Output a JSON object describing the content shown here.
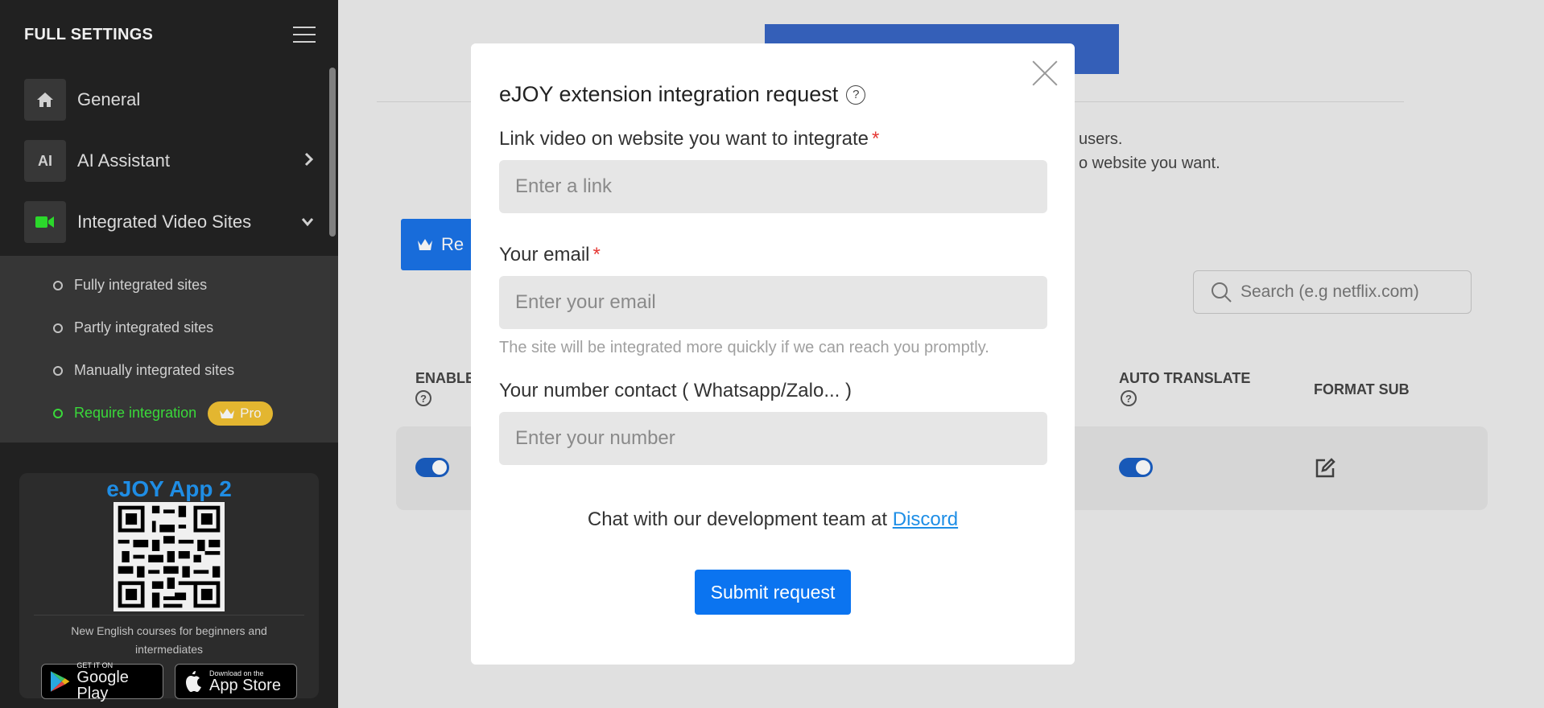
{
  "sidebar": {
    "title": "FULL SETTINGS",
    "menu": [
      {
        "label": "General",
        "icon": "home-icon",
        "icon_text": ""
      },
      {
        "label": "AI Assistant",
        "icon": "ai-icon",
        "icon_text": "AI"
      },
      {
        "label": "Integrated Video Sites",
        "icon": "video-camera-icon",
        "icon_text": ""
      }
    ],
    "submenu": [
      {
        "label": "Fully integrated sites"
      },
      {
        "label": "Partly integrated sites"
      },
      {
        "label": "Manually integrated sites"
      },
      {
        "label": "Require integration",
        "badge": "Pro"
      }
    ],
    "app_card": {
      "title": "eJOY App 2",
      "description": "New English courses for beginners and intermediates",
      "google_play": {
        "small": "GET IT ON",
        "big": "Google Play"
      },
      "app_store": {
        "small": "Download on the",
        "big": "App Store"
      }
    }
  },
  "main": {
    "partial_text_1": "users.",
    "partial_text_2": "o website you want.",
    "request_button": "Re",
    "search_placeholder": "Search (e.g netflix.com)",
    "columns": {
      "enable": "ENABLE",
      "auto_translate": "AUTO TRANSLATE",
      "format_sub": "FORMAT SUB"
    }
  },
  "modal": {
    "title": "eJOY extension integration request",
    "link_label": "Link video on website you want to integrate",
    "link_placeholder": "Enter a link",
    "email_label": "Your email",
    "email_placeholder": "Enter your email",
    "email_hint": "The site will be integrated more quickly if we can reach you promptly.",
    "number_label": "Your number contact ( Whatsapp/Zalo... )",
    "number_placeholder": "Enter your number",
    "chat_text": "Chat with our development team at",
    "discord_link": "Discord",
    "submit_label": "Submit request",
    "required_mark": "*"
  },
  "colors": {
    "accent_blue": "#0b74f0",
    "active_green": "#3ee63e",
    "pro_badge": "#f2c233",
    "sidebar_bg": "#242424"
  }
}
